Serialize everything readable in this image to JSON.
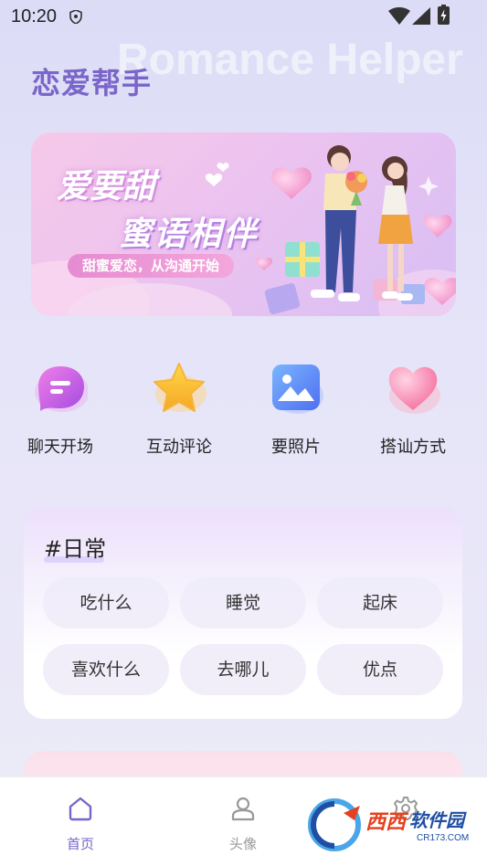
{
  "status_bar": {
    "time": "10:20"
  },
  "header": {
    "title": "恋爱帮手",
    "background_text": "Romance Helper"
  },
  "banner": {
    "headline_1": "爱要甜",
    "headline_2": "蜜语相伴",
    "subtitle": "甜蜜爱恋，从沟通开始"
  },
  "quick_actions": [
    {
      "label": "聊天开场",
      "icon": "chat-bubble-icon"
    },
    {
      "label": "互动评论",
      "icon": "star-icon"
    },
    {
      "label": "要照片",
      "icon": "photo-icon"
    },
    {
      "label": "搭讪方式",
      "icon": "heart-icon"
    }
  ],
  "category_card": {
    "title": "#日常",
    "chips": [
      "吃什么",
      "睡觉",
      "起床",
      "喜欢什么",
      "去哪儿",
      "优点"
    ]
  },
  "bottom_nav": {
    "items": [
      {
        "label": "首页",
        "icon": "home-icon",
        "active": true
      },
      {
        "label": "头像",
        "icon": "person-icon",
        "active": false
      },
      {
        "label": "",
        "icon": "gear-icon",
        "active": false
      }
    ]
  },
  "watermark": {
    "brand_1": "西西",
    "brand_2": "软件园",
    "url": "CR173.COM"
  },
  "colors": {
    "accent": "#7a66c9",
    "nav_active": "#7a66c9",
    "nav_inactive": "#999999"
  }
}
